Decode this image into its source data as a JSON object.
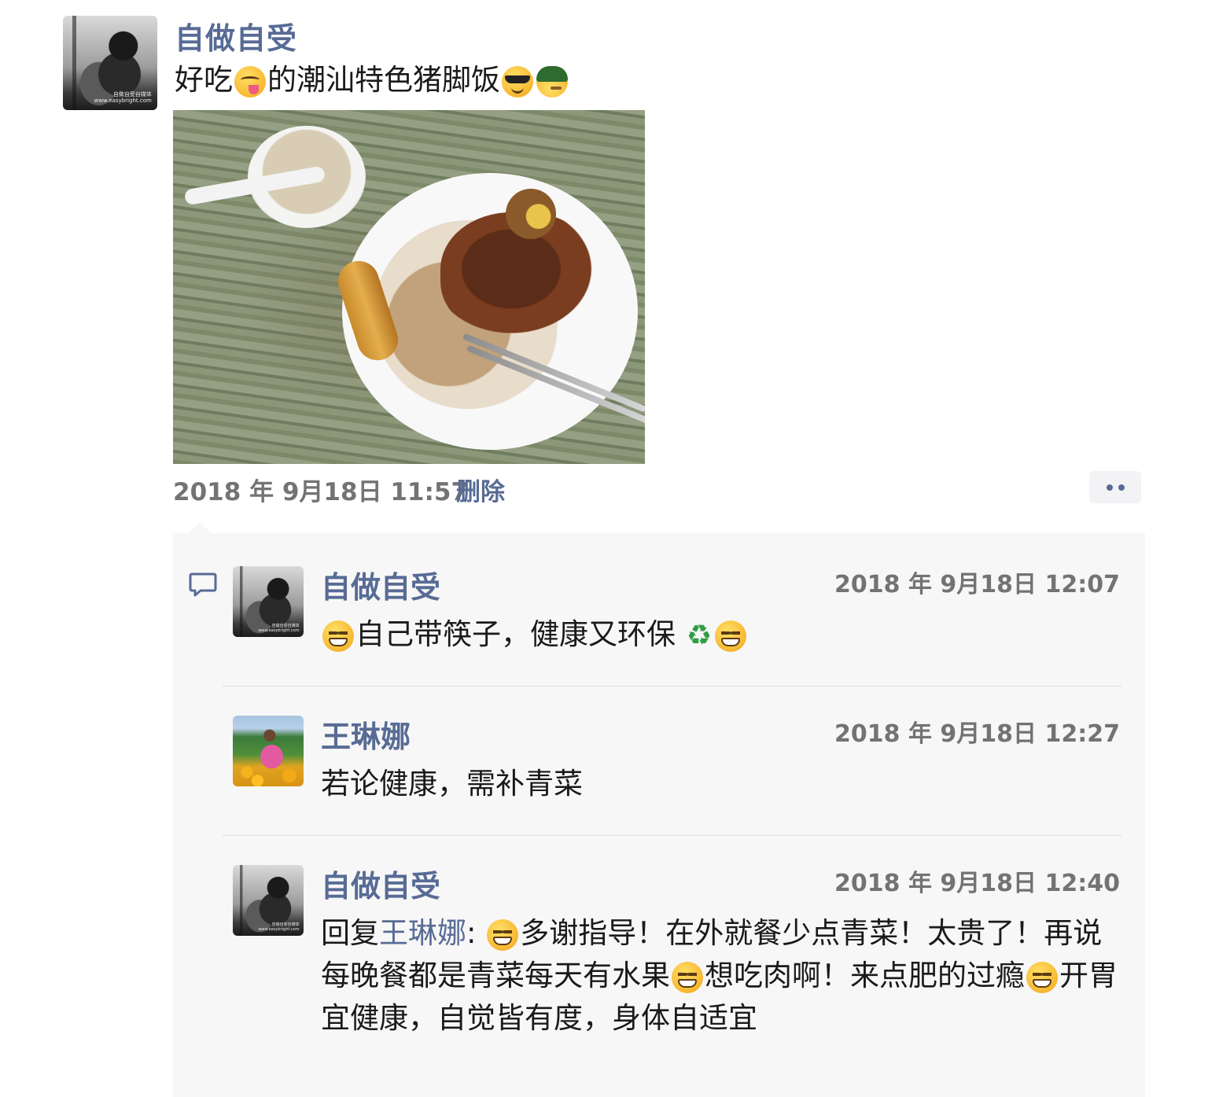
{
  "post": {
    "author": "自做自受",
    "avatar_watermark": "自做自受自媒体 www.easybright.com",
    "text_before_emoji1": "好吃",
    "emoji1": "yum-emoji",
    "text_after_emoji1": "的潮汕特色猪脚饭",
    "emoji2": "sunglasses-emoji",
    "emoji3": "cap-emoji",
    "photo": "photo-pork-knuckle-rice",
    "time": "2018 年 9月18日 11:57",
    "delete_label": "删除"
  },
  "comments": [
    {
      "author": "自做自受",
      "time": "2018 年 9月18日 12:07",
      "text_parts": [
        "自己带筷子，健康又环保"
      ]
    },
    {
      "author": "王琳娜",
      "time": "2018 年 9月18日 12:27",
      "text_parts": [
        "若论健康，需补青菜"
      ]
    },
    {
      "author": "自做自受",
      "time": "2018 年 9月18日 12:40",
      "reply_prefix": "回复",
      "reply_to": "王琳娜",
      "reply_colon": ":",
      "text_parts": [
        "多谢指导！在外就餐少点青菜！太贵了！再说每晚餐都是青菜每天有水果",
        "想吃肉啊！来点肥的过瘾",
        "开胃宜健康，自觉皆有度，身体自适宜"
      ]
    }
  ],
  "colors": {
    "name_link": "#576b95",
    "time_gray": "#737373",
    "panel_bg": "#f7f7f7"
  }
}
